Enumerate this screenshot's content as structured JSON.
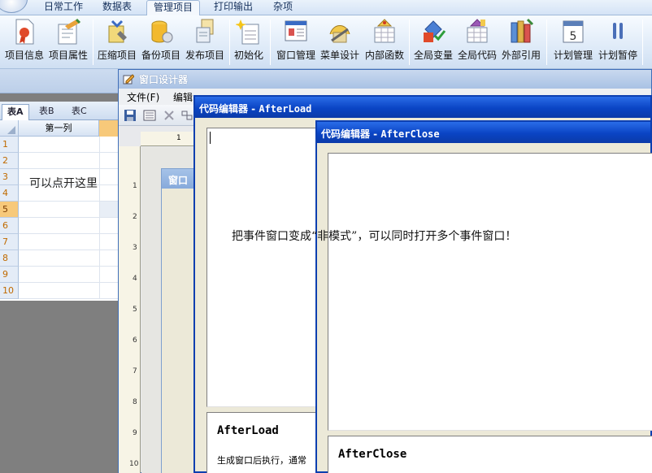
{
  "menu": {
    "tabs": [
      "日常工作",
      "数据表",
      "管理项目",
      "打印输出",
      "杂项"
    ],
    "active_tab": "管理项目"
  },
  "toolbar": {
    "items": [
      {
        "label": "项目信息",
        "icon": "project-info-icon"
      },
      {
        "label": "项目属性",
        "icon": "project-properties-icon"
      },
      {
        "label": "压缩项目",
        "icon": "compress-project-icon"
      },
      {
        "label": "备份项目",
        "icon": "backup-project-icon"
      },
      {
        "label": "发布项目",
        "icon": "publish-project-icon"
      },
      {
        "label": "初始化",
        "icon": "initialize-icon"
      },
      {
        "label": "窗口管理",
        "icon": "window-manage-icon"
      },
      {
        "label": "菜单设计",
        "icon": "menu-design-icon"
      },
      {
        "label": "内部函数",
        "icon": "internal-function-icon"
      },
      {
        "label": "全局变量",
        "icon": "global-variable-icon"
      },
      {
        "label": "全局代码",
        "icon": "global-code-icon"
      },
      {
        "label": "外部引用",
        "icon": "external-reference-icon"
      },
      {
        "label": "计划管理",
        "icon": "schedule-manage-icon"
      },
      {
        "label": "计划暂停",
        "icon": "schedule-pause-icon"
      }
    ]
  },
  "sheet": {
    "tabs": [
      "表A",
      "表B",
      "表C"
    ],
    "active_tab": "表A",
    "column_header": "第一列",
    "rows": [
      "1",
      "2",
      "3",
      "4",
      "5",
      "6",
      "7",
      "8",
      "9",
      "10"
    ],
    "selected_row": "5",
    "note": "可以点开这里"
  },
  "designer": {
    "title": "窗口设计器",
    "menu": [
      "文件(F)",
      "编辑"
    ],
    "ruler_top": [
      "1"
    ],
    "ruler_left": [
      "1",
      "2",
      "3",
      "4",
      "5",
      "6",
      "7",
      "8",
      "9",
      "10"
    ],
    "sub_window_title": "窗口"
  },
  "editor_load": {
    "title_prefix": "代码编辑器 - ",
    "event": "AfterLoad",
    "help_name": "AfterLoad",
    "help_desc": "生成窗口后执行，通常"
  },
  "editor_close": {
    "title_prefix": "代码编辑器 - ",
    "event": "AfterClose",
    "help_name": "AfterClose"
  },
  "overlay_note": "把事件窗口变成“非模式”，可以同时打开多个事件窗口！",
  "colors": {
    "title_bar": "#0a44c4",
    "ribbon": "#dbe8f7",
    "selected_row": "#f7c97a"
  }
}
